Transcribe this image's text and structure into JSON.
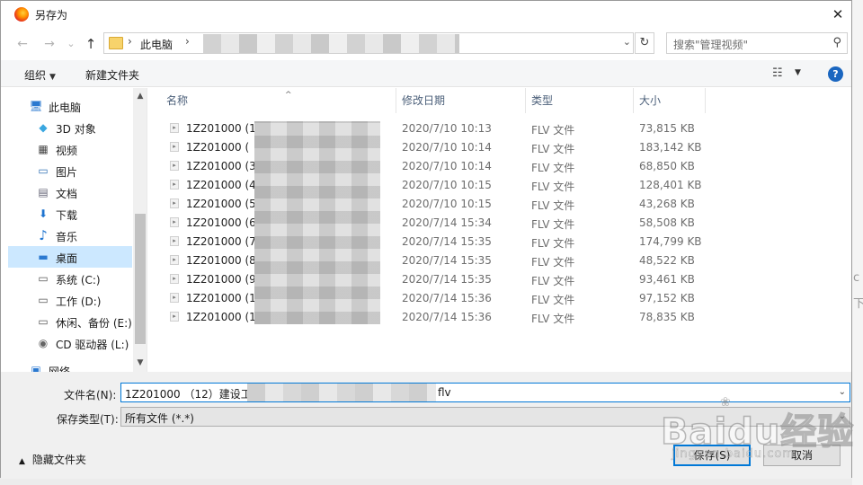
{
  "window": {
    "title": "另存为",
    "close_glyph": "✕"
  },
  "nav_buttons": {
    "back": "←",
    "forward": "→",
    "recent": "⌄",
    "up": "↑"
  },
  "address": {
    "separator": "›",
    "root": "此电脑",
    "dropdown": "⌄"
  },
  "refresh": "↻",
  "search": {
    "placeholder": "搜索\"管理视频\""
  },
  "toolbar": {
    "organize": "组织",
    "new_folder": "新建文件夹",
    "caret": "▼",
    "help": "?"
  },
  "sidebar": {
    "items": [
      {
        "label": "此电脑",
        "icon": "computer-icon",
        "glyph": "🖥"
      },
      {
        "label": "3D 对象",
        "icon": "cube-icon",
        "glyph": "◆"
      },
      {
        "label": "视频",
        "icon": "video-icon",
        "glyph": "▦"
      },
      {
        "label": "图片",
        "icon": "picture-icon",
        "glyph": "▭"
      },
      {
        "label": "文档",
        "icon": "document-icon",
        "glyph": "▤"
      },
      {
        "label": "下载",
        "icon": "download-icon",
        "glyph": "⬇"
      },
      {
        "label": "音乐",
        "icon": "music-icon",
        "glyph": "♪"
      },
      {
        "label": "桌面",
        "icon": "desktop-icon",
        "glyph": "▬"
      },
      {
        "label": "系统 (C:)",
        "icon": "drive-icon",
        "glyph": "▭"
      },
      {
        "label": "工作 (D:)",
        "icon": "drive-icon",
        "glyph": "▭"
      },
      {
        "label": "休闲、备份 (E:)",
        "icon": "drive-icon",
        "glyph": "▭"
      },
      {
        "label": "CD 驱动器 (L:)",
        "icon": "cd-drive-icon",
        "glyph": "◉"
      },
      {
        "label": "网络",
        "icon": "network-icon",
        "glyph": "▣"
      }
    ],
    "selected": "桌面",
    "scroll_up": "▲",
    "scroll_down": "▼"
  },
  "columns": {
    "name": "名称",
    "modified": "修改日期",
    "type": "类型",
    "size": "大小",
    "sort_glyph": "^"
  },
  "files": [
    {
      "name": "1Z201000   (1",
      "modified": "2020/7/10 10:13",
      "type": "FLV 文件",
      "size": "73,815 KB"
    },
    {
      "name": "1Z201000   (",
      "modified": "2020/7/10 10:14",
      "type": "FLV 文件",
      "size": "183,142 KB"
    },
    {
      "name": "1Z201000   (3",
      "modified": "2020/7/10 10:14",
      "type": "FLV 文件",
      "size": "68,850 KB"
    },
    {
      "name": "1Z201000   (4,",
      "modified": "2020/7/10 10:15",
      "type": "FLV 文件",
      "size": "128,401 KB"
    },
    {
      "name": "1Z201000   (5)",
      "modified": "2020/7/10 10:15",
      "type": "FLV 文件",
      "size": "43,268 KB"
    },
    {
      "name": "1Z201000   (6)",
      "modified": "2020/7/14 15:34",
      "type": "FLV 文件",
      "size": "58,508 KB"
    },
    {
      "name": "1Z201000   (7)",
      "modified": "2020/7/14 15:35",
      "type": "FLV 文件",
      "size": "174,799 KB"
    },
    {
      "name": "1Z201000   (8)",
      "modified": "2020/7/14 15:35",
      "type": "FLV 文件",
      "size": "48,522 KB"
    },
    {
      "name": "1Z201000   (9",
      "modified": "2020/7/14 15:35",
      "type": "FLV 文件",
      "size": "93,461 KB"
    },
    {
      "name": "1Z201000   (1",
      "modified": "2020/7/14 15:36",
      "type": "FLV 文件",
      "size": "97,152 KB"
    },
    {
      "name": "1Z201000   (1",
      "modified": "2020/7/14 15:36",
      "type": "FLV 文件",
      "size": "78,835 KB"
    }
  ],
  "file_icon_glyph": "▸",
  "form": {
    "filename_label": "文件名(N):",
    "filename_prefix": "1Z201000  （12）建设工",
    "filename_suffix": "flv",
    "type_label": "保存类型(T):",
    "type_value": "所有文件 (*.*)",
    "caret": "⌄"
  },
  "hide_folders": {
    "label": "隐藏文件夹",
    "chevron": "▲"
  },
  "buttons": {
    "save": "保存(S)",
    "cancel": "取消"
  },
  "right_edge": {
    "glyph_1": "c",
    "glyph_2": "下"
  },
  "watermark": {
    "main": "Baidu经验",
    "sub": "jingyan.baidu.com",
    "paw": "❀"
  },
  "colors": {
    "accent": "#0078d7",
    "selection": "#cce8ff",
    "header_text": "#4c607a",
    "help": "#1a66c0"
  }
}
